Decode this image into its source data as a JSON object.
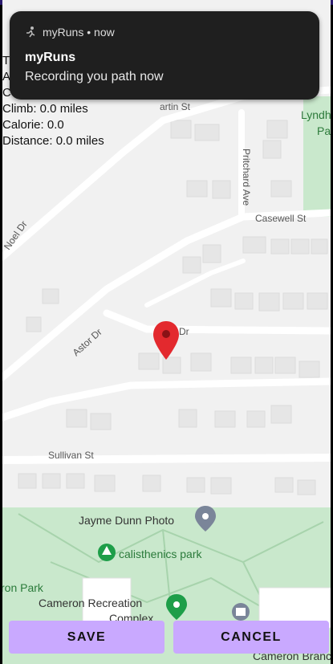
{
  "notification": {
    "app_name": "myRuns",
    "time": "now",
    "title": "myRuns",
    "message": "Recording you path now"
  },
  "stats": {
    "line1": "T",
    "line2": "A",
    "line3": "C",
    "climb": "Climb: 0.0 miles",
    "calorie": "Calorie: 0.0",
    "distance": "Distance: 0.0 miles"
  },
  "map": {
    "streets": {
      "martin": "artin St",
      "pritchard": "Pritchard Ave",
      "casewell": "Casewell St",
      "noel": "Noel Dr",
      "astor": "Astor Dr",
      "w_dr": "W",
      "w_dr_end": "Dr",
      "sullivan": "Sullivan St",
      "lyndh": "Lyndh",
      "lyndh2": "Pa"
    },
    "places": {
      "photo": "Jayme Dunn Photo",
      "park": "calisthenics park",
      "ron_park": "ron Park",
      "recreation": "Cameron Recreation",
      "complex": "Complex",
      "branch": "Cameron Branch"
    },
    "colors": {
      "park": "#c9e8cc",
      "marker": "#e3292e",
      "green_pin": "#1e9e49",
      "grey_pin": "#7a8599"
    }
  },
  "buttons": {
    "save": "SAVE",
    "cancel": "CANCEL"
  }
}
